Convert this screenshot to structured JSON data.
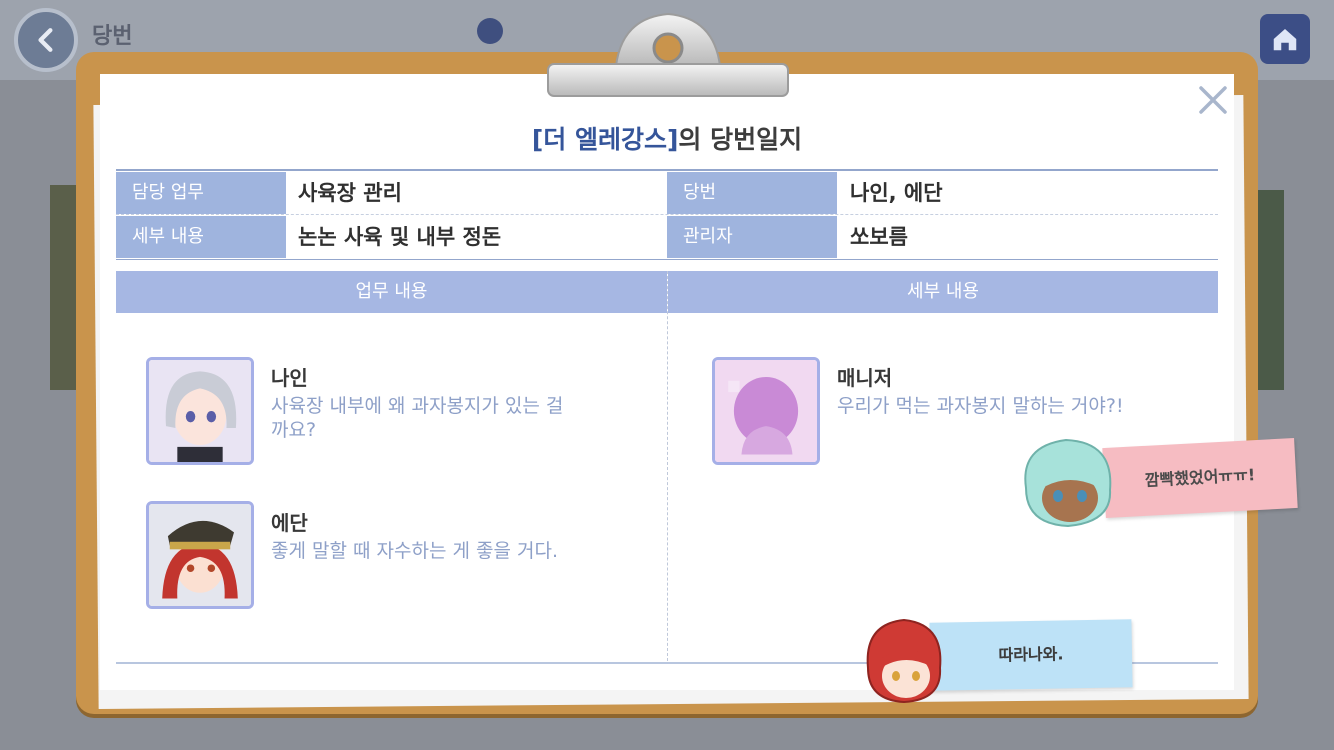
{
  "background": {
    "header_title": "당번"
  },
  "dialog": {
    "title_accent": "[더 엘레강스]",
    "title_rest": "의 당번일지",
    "info": {
      "duty_label": "담당 업무",
      "duty_value": "사육장 관리",
      "detail_label": "세부 내용",
      "detail_value": "논논 사육 및 내부 정돈",
      "onduty_label": "당번",
      "onduty_value": "나인, 에단",
      "manager_label": "관리자",
      "manager_value": "쏘보름"
    },
    "sections": {
      "left_header": "업무 내용",
      "right_header": "세부 내용"
    },
    "entries": [
      {
        "name": "나인",
        "message": "사육장 내부에 왜 과자봉지가 있는 걸까요?"
      },
      {
        "name": "에단",
        "message": "좋게 말할 때 자수하는 게 좋을 거다."
      },
      {
        "name": "매니저",
        "message": "우리가 먹는 과자봉지 말하는 거야?!"
      }
    ],
    "stickers": [
      {
        "text": "깜빡했었어ㅠㅠ!",
        "color": "#f6bcc2"
      },
      {
        "text": "따라나와.",
        "color": "#bde2f7"
      }
    ]
  },
  "colors": {
    "board": "#c9944c",
    "label_bg": "#9fb4de",
    "title_accent": "#35559a",
    "message": "#8ea0c8"
  }
}
